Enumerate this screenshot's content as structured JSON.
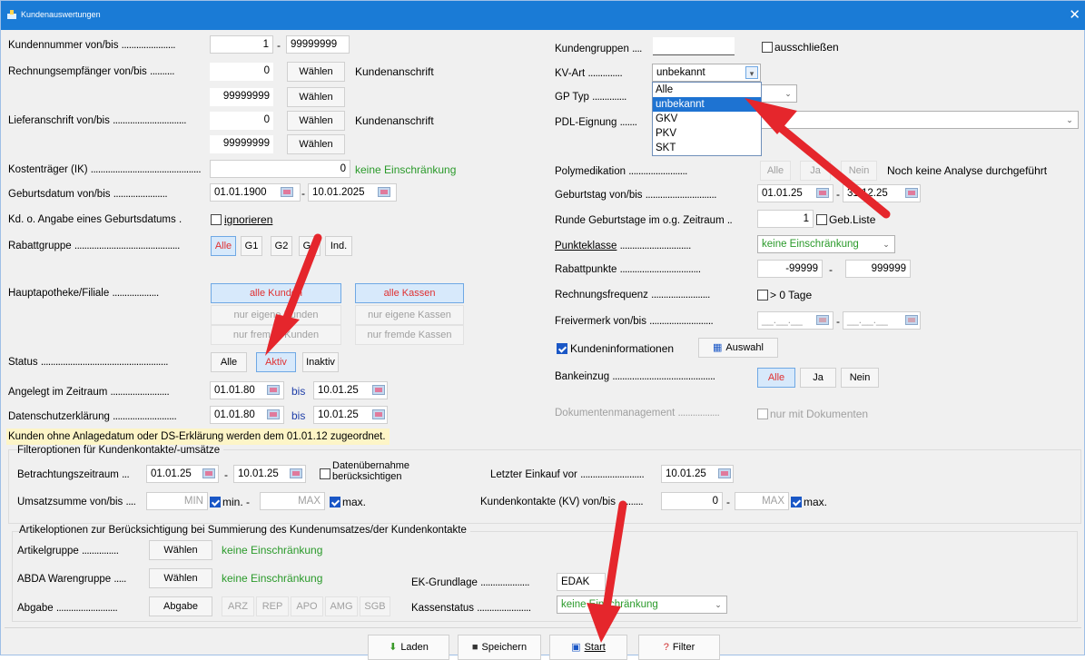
{
  "window": {
    "title": "Kundenauswertungen",
    "close_glyph": "✕"
  },
  "left": {
    "kundennummer": {
      "label": "Kundennummer von/bis",
      "from": "1",
      "sep": "-",
      "to": "99999999"
    },
    "rechnungsempfaenger": {
      "label": "Rechnungsempfänger von/bis",
      "from": "0",
      "to": "99999999",
      "choose": "Wählen",
      "info": "Kundenanschrift"
    },
    "lieferanschrift": {
      "label": "Lieferanschrift von/bis",
      "from": "0",
      "to": "99999999",
      "choose": "Wählen",
      "info": "Kundenanschrift"
    },
    "kostentraeger": {
      "label": "Kostenträger (IK)",
      "value": "0",
      "info": "keine Einschränkung"
    },
    "geburtsdatum": {
      "label": "Geburtsdatum von/bis",
      "from": "01.01.1900",
      "sep": "-",
      "to": "10.01.2025"
    },
    "kd_ohne_geburtsdatum": {
      "label": "Kd. o. Angabe eines Geburtsdatums",
      "option": "ignorieren"
    },
    "rabattgruppe": {
      "label": "Rabattgruppe",
      "options": [
        "Alle",
        "G1",
        "G2",
        "G3",
        "Ind."
      ]
    },
    "hauptapotheke": {
      "label": "Hauptapotheke/Filiale",
      "buttons": [
        "alle Kunden",
        "alle Kassen",
        "nur eigene Kunden",
        "nur eigene Kassen",
        "nur fremde Kunden",
        "nur fremde Kassen"
      ]
    },
    "status": {
      "label": "Status",
      "options": [
        "Alle",
        "Aktiv",
        "Inaktiv"
      ]
    },
    "angelegt": {
      "label": "Angelegt im Zeitraum",
      "from": "01.01.80",
      "bis": "bis",
      "to": "10.01.25"
    },
    "datenschutz": {
      "label": "Datenschutzerklärung",
      "from": "01.01.80",
      "bis": "bis",
      "to": "10.01.25"
    }
  },
  "right": {
    "kundengruppen": {
      "label": "Kundengruppen",
      "checkbox": "ausschließen"
    },
    "kv_art": {
      "label": "KV-Art",
      "selected": "unbekannt",
      "options": [
        "Alle",
        "unbekannt",
        "GKV",
        "PKV",
        "SKT"
      ]
    },
    "gp_typ": {
      "label": "GP Typ"
    },
    "pdl": {
      "label": "PDL-Eignung"
    },
    "polymedikation": {
      "label": "Polymedikation",
      "buttons": [
        "Alle",
        "Ja",
        "Nein"
      ],
      "info": "Noch keine Analyse durchgeführt"
    },
    "geburtstag": {
      "label": "Geburtstag von/bis",
      "from": "01.01.25",
      "sep": "-",
      "to": "31.12.25"
    },
    "runde": {
      "label": "Runde Geburtstage im o.g. Zeitraum",
      "value": "1",
      "option": "Geb.Liste"
    },
    "punkteklasse": {
      "label": "Punkteklasse",
      "value": "keine Einschränkung"
    },
    "rabattpunkte": {
      "label": "Rabattpunkte",
      "from": "-99999",
      "sep": "-",
      "to": "999999"
    },
    "rechnungsfrequenz": {
      "label": "Rechnungsfrequenz",
      "option": "> 0 Tage"
    },
    "freivermerk": {
      "label": "Freivermerk von/bis",
      "from": "__.__.__",
      "sep": "-",
      "to": "__.__.__"
    },
    "kundeninformationen": {
      "label": "Kundeninformationen",
      "button": "Auswahl"
    },
    "bankeinzug": {
      "label": "Bankeinzug",
      "options": [
        "Alle",
        "Ja",
        "Nein"
      ]
    },
    "dokumente": {
      "label": "Dokumentenmanagement",
      "option": "nur mit Dokumenten"
    }
  },
  "note": "Kunden ohne Anlagedatum oder DS-Erklärung werden dem 01.01.12 zugeordnet.",
  "filter": {
    "title": "Filteroptionen für Kundenkontakte/-umsätze",
    "betrachtung": {
      "label": "Betrachtungszeitraum",
      "from": "01.01.25",
      "sep": "-",
      "to": "10.01.25",
      "option_line1": "Datenübernahme",
      "option_line2": "berücksichtigen"
    },
    "letzter_einkauf": {
      "label": "Letzter Einkauf vor",
      "value": "10.01.25"
    },
    "umsatzsumme": {
      "label": "Umsatzsumme von/bis",
      "min": "MIN",
      "min_label": "min.",
      "sep": "-",
      "max": "MAX",
      "max_label": "max."
    },
    "kundenkontakte": {
      "label": "Kundenkontakte (KV) von/bis",
      "from": "0",
      "sep": "-",
      "max": "MAX",
      "max_label": "max."
    }
  },
  "artikel": {
    "title": "Artikeloptionen zur Berücksichtigung bei Summierung des Kundenumsatzes/der Kundenkontakte",
    "artikelgruppe": {
      "label": "Artikelgruppe",
      "button": "Wählen",
      "info": "keine Einschränkung"
    },
    "abda": {
      "label": "ABDA Warengruppe",
      "button": "Wählen",
      "info": "keine Einschränkung"
    },
    "ek_grundlage": {
      "label": "EK-Grundlage",
      "value": "EDAK"
    },
    "abgabe": {
      "label": "Abgabe",
      "button": "Abgabe",
      "chips": [
        "ARZ",
        "REP",
        "APO",
        "AMG",
        "SGB"
      ]
    },
    "kassenstatus": {
      "label": "Kassenstatus",
      "value": "keine Einschränkung"
    }
  },
  "bottom": {
    "laden": "Laden",
    "speichern": "Speichern",
    "start": "Start",
    "filter": "Filter"
  },
  "colors": {
    "titlebar": "#1a7bd6",
    "selected": "#d7e9fb",
    "accent_red": "#e03030",
    "green_text": "#2a9a2a",
    "arrow": "#e5262c"
  }
}
